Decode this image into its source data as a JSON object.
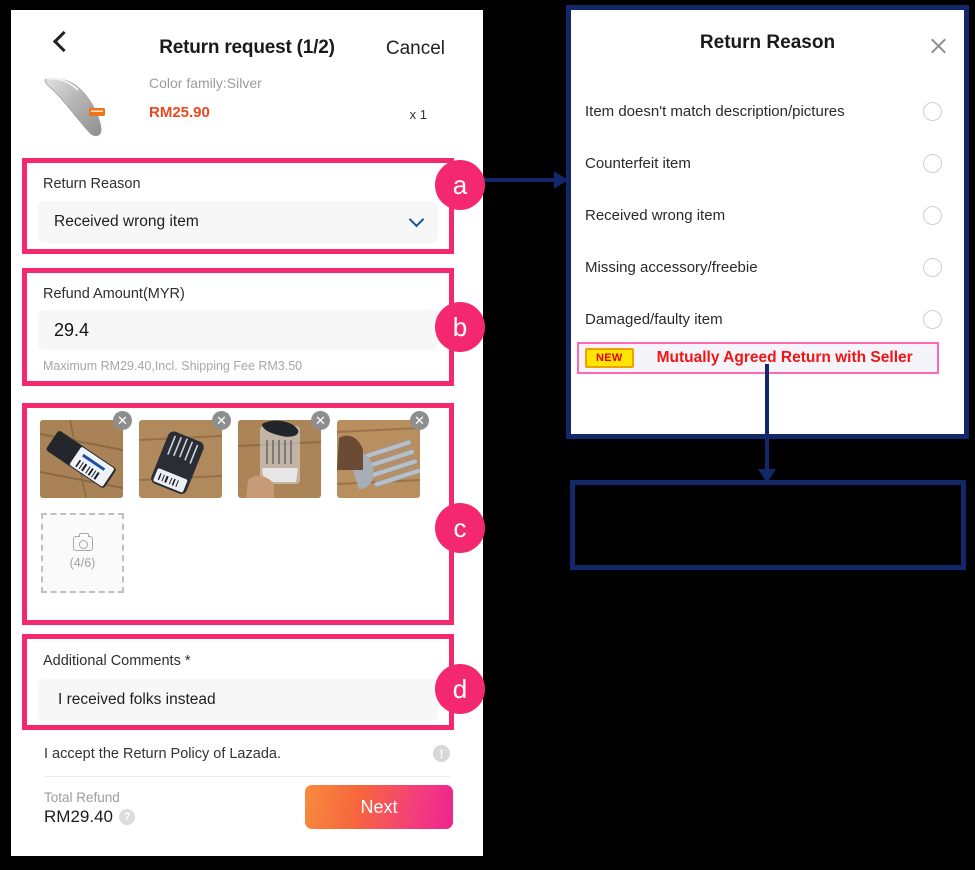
{
  "phone": {
    "header": {
      "back_icon": "chevron-left-icon",
      "title": "Return request (1/2)",
      "cancel_label": "Cancel"
    },
    "product": {
      "color_family": "Color family:Silver",
      "price": "RM25.90",
      "quantity": "x 1"
    },
    "return_reason": {
      "label": "Return Reason",
      "value": "Received wrong item",
      "chevron_icon": "chevron-down-icon"
    },
    "refund_amount": {
      "label": "Refund Amount(MYR)",
      "value": "29.4",
      "hint": "Maximum RM29.40,Incl. Shipping Fee RM3.50"
    },
    "photos": {
      "thumbnails": [
        {
          "alt": "packaged-cutlery-on-floor"
        },
        {
          "alt": "rolled-cutlery-bundle"
        },
        {
          "alt": "cutlery-in-plastic-held"
        },
        {
          "alt": "forks-close-up"
        }
      ],
      "close_icon": "close-icon",
      "camera_icon": "camera-icon",
      "counter": "(4/6)"
    },
    "comments": {
      "label": "Additional Comments *",
      "value": "I received folks instead"
    },
    "policy": {
      "text": "I accept the Return Policy of Lazada.",
      "info_icon": "info-icon",
      "info_glyph": "!"
    },
    "footer": {
      "total_label": "Total Refund",
      "total_value": "RM29.40",
      "help_icon": "question-icon",
      "help_glyph": "?",
      "next_label": "Next"
    }
  },
  "dialog": {
    "title": "Return Reason",
    "close_icon": "close-icon",
    "options": [
      {
        "label": "Item doesn't match description/pictures",
        "selected": false
      },
      {
        "label": "Counterfeit item",
        "selected": false
      },
      {
        "label": "Received wrong item",
        "selected": false
      },
      {
        "label": "Missing accessory/freebie",
        "selected": false
      },
      {
        "label": "Damaged/faulty item",
        "selected": false
      }
    ],
    "highlighted_option": {
      "badge": "NEW",
      "label": "Mutually Agreed Return with Seller"
    }
  },
  "callouts": {
    "a": "a",
    "b": "b",
    "c": "c",
    "d": "d"
  },
  "colors": {
    "accent_pink": "#f3286f",
    "navy": "#12286b",
    "price_orange": "#e8491f",
    "new_badge_yellow": "#ffe500",
    "new_badge_red": "#e8001c",
    "highlight_red": "#f01414"
  }
}
